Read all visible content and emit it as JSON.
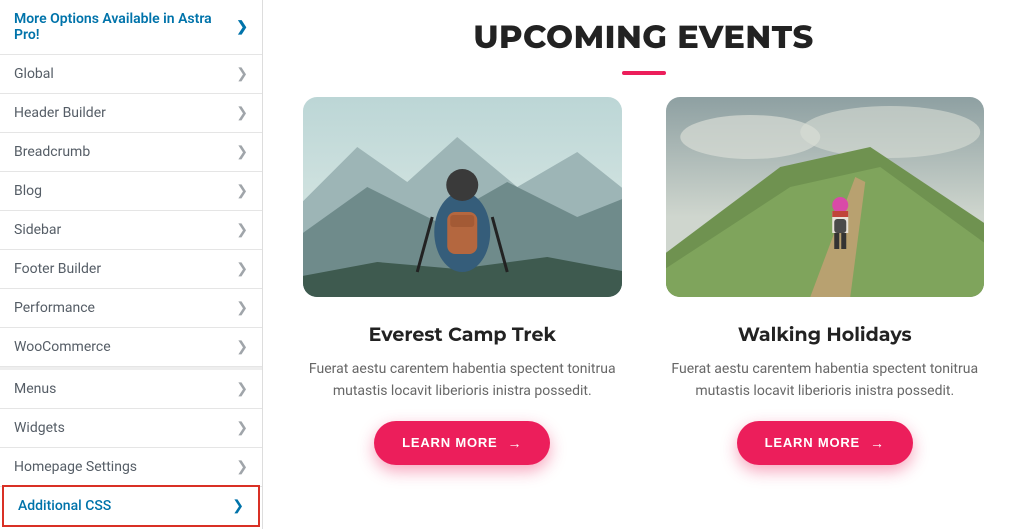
{
  "sidebar": {
    "promo": "More Options Available in Astra Pro!",
    "group1": [
      "Global",
      "Header Builder",
      "Breadcrumb",
      "Blog",
      "Sidebar",
      "Footer Builder",
      "Performance",
      "WooCommerce"
    ],
    "group2": [
      "Menus",
      "Widgets",
      "Homepage Settings"
    ],
    "active": "Additional CSS"
  },
  "content": {
    "heading": "UPCOMING EVENTS",
    "cards": [
      {
        "title": "Everest Camp Trek",
        "desc": "Fuerat aestu carentem habentia spectent tonitrua mutastis locavit liberioris inistra possedit.",
        "cta": "LEARN MORE"
      },
      {
        "title": "Walking Holidays",
        "desc": "Fuerat aestu carentem habentia spectent tonitrua mutastis locavit liberioris inistra possedit.",
        "cta": "LEARN MORE"
      }
    ]
  },
  "colors": {
    "accent": "#ec1e5b",
    "link": "#0073aa"
  }
}
